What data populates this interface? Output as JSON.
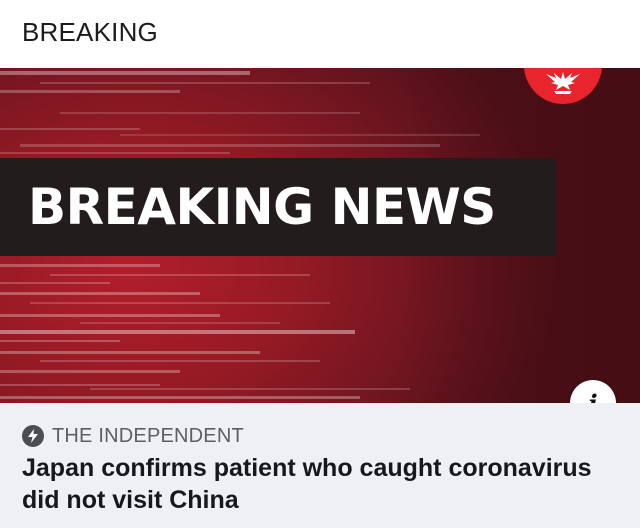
{
  "header": {
    "title": "BREAKING"
  },
  "banner": {
    "headline": "BREAKING NEWS",
    "logo_icon": "eagle-icon",
    "info_icon": "info-icon",
    "info_label": "i",
    "colors": {
      "banner_red": "#951a24",
      "headline_box": "#221c1c",
      "logo_red": "#e8242c"
    }
  },
  "article": {
    "source_icon": "lightning-bolt-icon",
    "source": "THE INDEPENDENT",
    "title": "Japan confirms patient who caught coronavirus did not visit China"
  }
}
